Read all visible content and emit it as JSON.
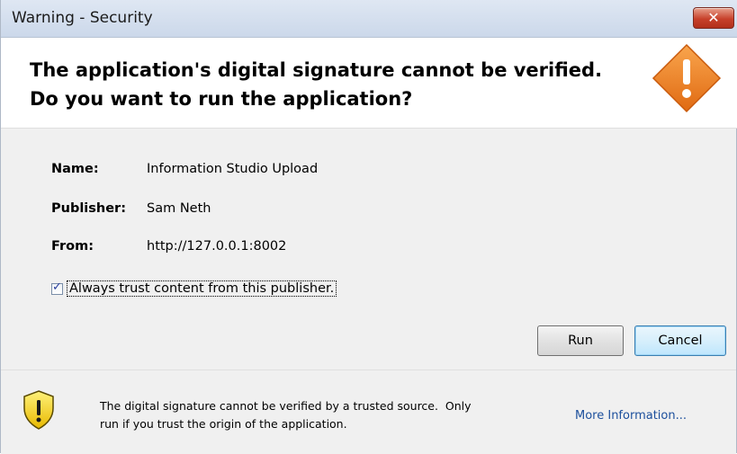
{
  "window": {
    "title": "Warning - Security",
    "close_label": "✕"
  },
  "header": {
    "headline_line1": "The application's digital signature cannot be verified.",
    "headline_line2": "Do you want to run the application?",
    "icon": "warning-diamond-icon"
  },
  "details": [
    {
      "label": "Name:",
      "value": "Information Studio Upload"
    },
    {
      "label": "Publisher:",
      "value": "Sam Neth"
    },
    {
      "label": "From:",
      "value": "http://127.0.0.1:8002"
    }
  ],
  "trust_checkbox": {
    "label": "Always trust content from this publisher.",
    "checked": true
  },
  "buttons": {
    "run": "Run",
    "cancel": "Cancel"
  },
  "footer": {
    "icon": "shield-warning-icon",
    "message_line1": "The digital signature cannot be verified by a trusted source.  Only",
    "message_line2": "run if you trust the origin of the application.",
    "more_info": "More Information..."
  },
  "colors": {
    "warning_orange": "#ee7f22",
    "shield_yellow": "#f4d21e",
    "link_blue": "#1c4f9c"
  }
}
